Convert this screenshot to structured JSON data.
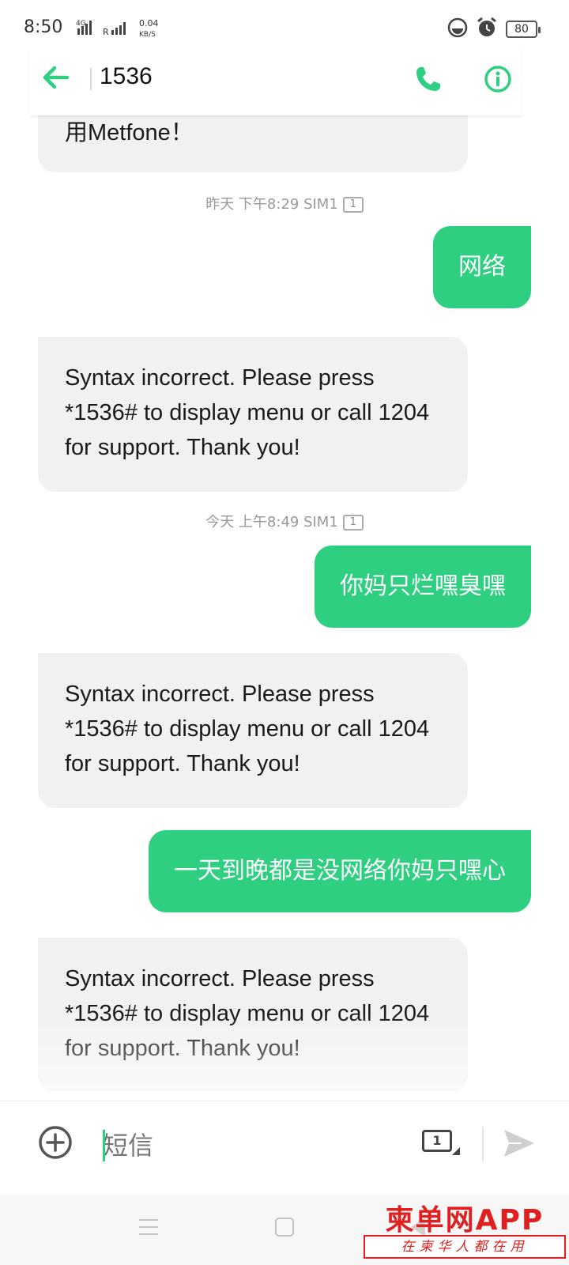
{
  "status_bar": {
    "time": "8:50",
    "network_type": "4G",
    "roaming": "R",
    "speed_value": "0.04",
    "speed_unit": "KB/S",
    "battery": "80"
  },
  "header": {
    "title": "1536",
    "back_icon": "arrow-left-icon",
    "call_icon": "phone-icon",
    "info_icon": "info-icon"
  },
  "conversation": {
    "partial_message": "用Metfone！",
    "timestamp_1": {
      "text": "昨天 下午8:29  SIM1",
      "sim": "1"
    },
    "sent_1": "网络",
    "received_1": "Syntax incorrect. Please press *1536# to display menu or call 1204 for support. Thank you!",
    "timestamp_2": {
      "text": "今天 上午8:49  SIM1",
      "sim": "1"
    },
    "sent_2": "你妈只烂嘿臭嘿",
    "received_2": "Syntax incorrect. Please press *1536# to display menu or call 1204 for support. Thank you!",
    "sent_3": "一天到晚都是没网络你妈只嘿心",
    "received_3": "Syntax incorrect. Please press *1536# to display menu or call 1204 for support. Thank you!"
  },
  "compose": {
    "placeholder": "短信",
    "sim_selector": "1",
    "add_icon": "plus-circle-icon",
    "send_icon": "send-icon"
  },
  "watermark": {
    "brand": "柬单网APP",
    "slogan": "在柬华人都在用"
  },
  "colors": {
    "accent": "#2ecf80",
    "incoming_bubble": "#f1f1f1",
    "watermark": "#e02020"
  }
}
